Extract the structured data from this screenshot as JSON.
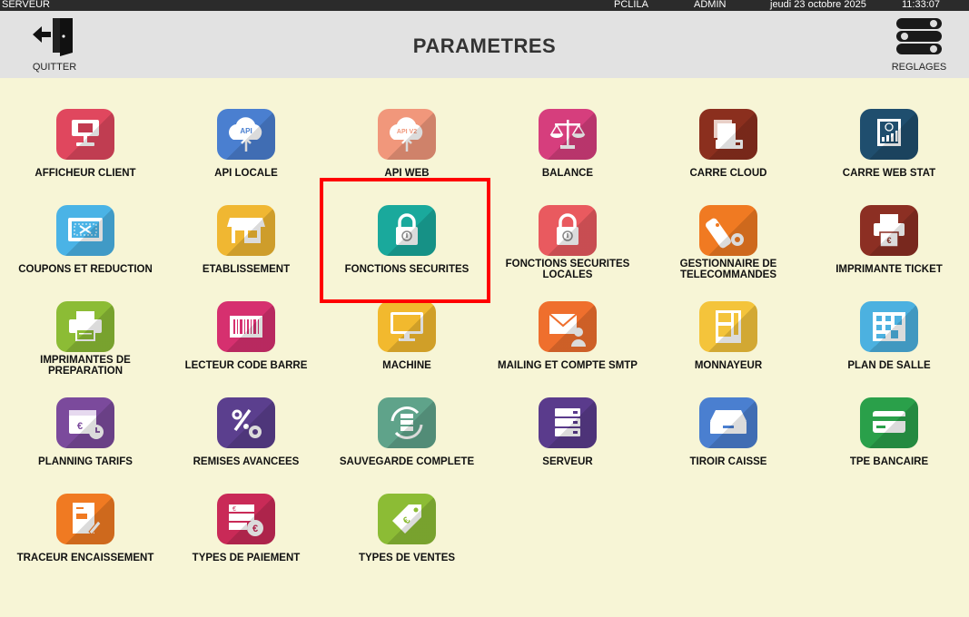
{
  "statusbar": {
    "server": "SERVEUR",
    "station": "PCLILA",
    "user": "ADMIN",
    "date": "jeudi 23 octobre 2025",
    "time": "11:33:07"
  },
  "header": {
    "title": "PARAMETRES",
    "quit_label": "QUITTER",
    "settings_label": "REGLAGES"
  },
  "items": [
    {
      "label": "AFFICHEUR CLIENT",
      "color": "#e0475e",
      "icon": "display-icon"
    },
    {
      "label": "API LOCALE",
      "color": "#4a7fd0",
      "icon": "cloud-api-icon",
      "text": "API"
    },
    {
      "label": "API WEB",
      "color": "#f1977b",
      "icon": "cloud-api-v2-icon",
      "text": "API V2"
    },
    {
      "label": "BALANCE",
      "color": "#d63e7d",
      "icon": "scale-icon"
    },
    {
      "label": "CARRE CLOUD",
      "color": "#8b2f1e",
      "icon": "server-box-icon"
    },
    {
      "label": "CARRE WEB STAT",
      "color": "#1f4e6e",
      "icon": "web-stat-icon"
    },
    {
      "label": "COUPONS ET REDUCTION",
      "color": "#4ab3e6",
      "icon": "coupon-icon"
    },
    {
      "label": "ETABLISSEMENT",
      "color": "#f0b732",
      "icon": "shop-icon"
    },
    {
      "label": "FONCTIONS SECURITES",
      "color": "#1aa99c",
      "icon": "padlock-icon"
    },
    {
      "label": "FONCTIONS SECURITES LOCALES",
      "color": "#e95a5f",
      "icon": "padlock-icon"
    },
    {
      "label": "GESTIONNAIRE DE TELECOMMANDES",
      "color": "#f07a22",
      "icon": "remote-control-icon"
    },
    {
      "label": "IMPRIMANTE TICKET",
      "color": "#8c2f23",
      "icon": "ticket-printer-icon"
    },
    {
      "label": "IMPRIMANTES DE PREPARATION",
      "color": "#8cbc35",
      "icon": "printer-icon"
    },
    {
      "label": "LECTEUR CODE BARRE",
      "color": "#d6306f",
      "icon": "barcode-icon"
    },
    {
      "label": "MACHINE",
      "color": "#f2b92e",
      "icon": "monitor-icon"
    },
    {
      "label": "MAILING ET COMPTE SMTP",
      "color": "#ef6f2d",
      "icon": "mail-user-icon"
    },
    {
      "label": "MONNAYEUR",
      "color": "#f4c43b",
      "icon": "cash-machine-icon"
    },
    {
      "label": "PLAN DE SALLE",
      "color": "#4cb1e0",
      "icon": "floor-plan-icon"
    },
    {
      "label": "PLANNING TARIFS",
      "color": "#7b4a9c",
      "icon": "calendar-euro-icon"
    },
    {
      "label": "REMISES AVANCEES",
      "color": "#5b3f8e",
      "icon": "percent-gear-icon"
    },
    {
      "label": "SAUVEGARDE COMPLETE",
      "color": "#5fa38a",
      "icon": "backup-sync-icon"
    },
    {
      "label": "SERVEUR",
      "color": "#5a3b8c",
      "icon": "server-stack-icon"
    },
    {
      "label": "TIROIR CAISSE",
      "color": "#4a7fd0",
      "icon": "cash-drawer-icon"
    },
    {
      "label": "TPE BANCAIRE",
      "color": "#2aa04a",
      "icon": "card-icon"
    },
    {
      "label": "TRACEUR ENCAISSEMENT",
      "color": "#f07a22",
      "icon": "receipt-trace-icon"
    },
    {
      "label": "TYPES DE PAIEMENT",
      "color": "#c92a57",
      "icon": "payment-euro-icon"
    },
    {
      "label": "TYPES DE VENTES",
      "color": "#8cbc35",
      "icon": "price-tag-icon"
    }
  ]
}
